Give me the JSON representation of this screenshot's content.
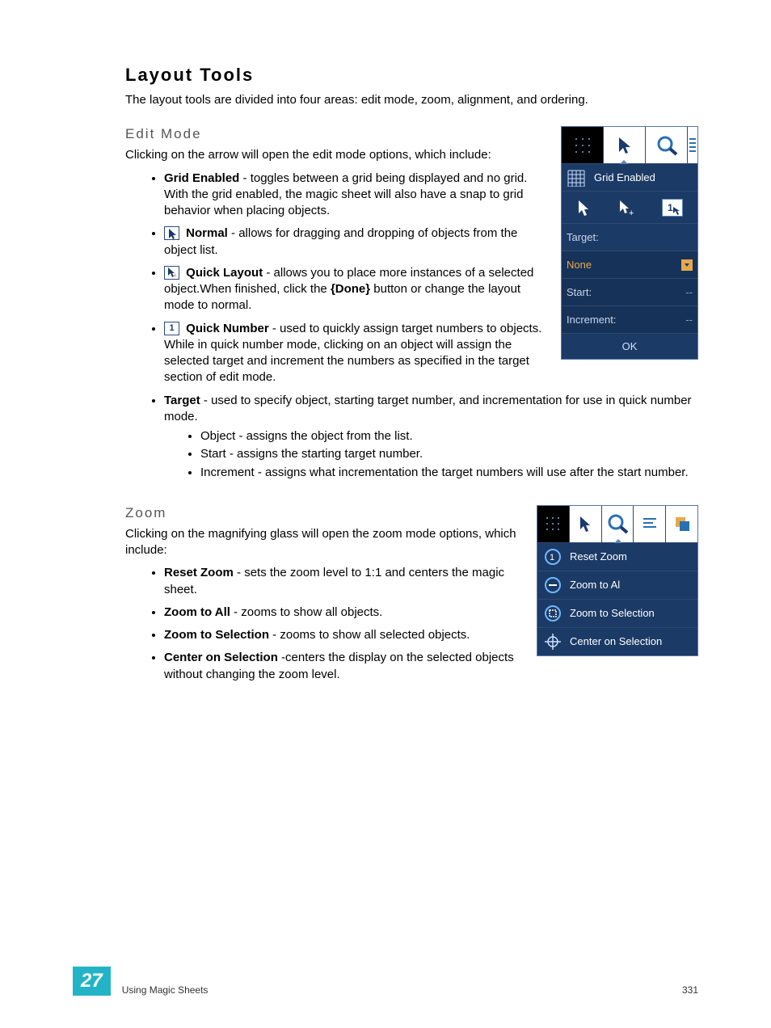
{
  "title": "Layout Tools",
  "intro": "The layout tools are divided into four areas: edit mode, zoom, alignment, and ordering.",
  "sections": {
    "edit": {
      "heading": "Edit Mode",
      "lead": "Clicking on the arrow will open the edit mode options, which include:",
      "items": {
        "gridEnabled": {
          "label": "Grid Enabled",
          "text": " - toggles between a grid being displayed and no grid. With the grid enabled, the magic sheet will also have a snap to grid behavior when placing objects."
        },
        "normal": {
          "label": "Normal",
          "text": " - allows for dragging and dropping of objects from the object list."
        },
        "quickLayout": {
          "label": "Quick Layout",
          "text_a": " - allows you to place more instances of a selected object.When finished, click the ",
          "done": "{Done}",
          "text_b": " button or change the layout mode to normal."
        },
        "quickNumber": {
          "label": "Quick Number",
          "text": " - used to quickly assign target numbers to objects. While in quick number mode, clicking on an object will assign the selected target and increment the numbers as specified in the target section of edit mode."
        },
        "target": {
          "label": "Target",
          "text": " - used to specify object, starting target number, and incrementation for use in quick number mode.",
          "sub": {
            "object": "Object - assigns the object from the list.",
            "start": "Start - assigns the starting target number.",
            "increment": "Increment - assigns what incrementation the target numbers will use after the start number."
          }
        }
      }
    },
    "zoom": {
      "heading": "Zoom",
      "lead": "Clicking on the magnifying glass will open the zoom mode options, which include:",
      "items": {
        "reset": {
          "label": "Reset Zoom",
          "text": " - sets the zoom level to 1:1 and centers the magic sheet."
        },
        "all": {
          "label": "Zoom to All",
          "text": " - zooms to show all objects."
        },
        "sel": {
          "label": "Zoom to Selection",
          "text": " - zooms to show all selected objects."
        },
        "center": {
          "label": "Center on Selection",
          "text": " -centers the display on the selected objects without changing the zoom level."
        }
      }
    }
  },
  "panelEdit": {
    "gridEnabled": "Grid Enabled",
    "targetLabel": "Target:",
    "targetValue": "None",
    "startLabel": "Start:",
    "incrementLabel": "Increment:",
    "dash": "--",
    "ok": "OK"
  },
  "panelZoom": {
    "reset": "Reset Zoom",
    "all": "Zoom to Al",
    "sel": "Zoom to Selection",
    "center": "Center on Selection"
  },
  "footer": {
    "chapter": "27",
    "label": "Using Magic Sheets",
    "page": "331"
  },
  "icons": {
    "one": "1"
  }
}
